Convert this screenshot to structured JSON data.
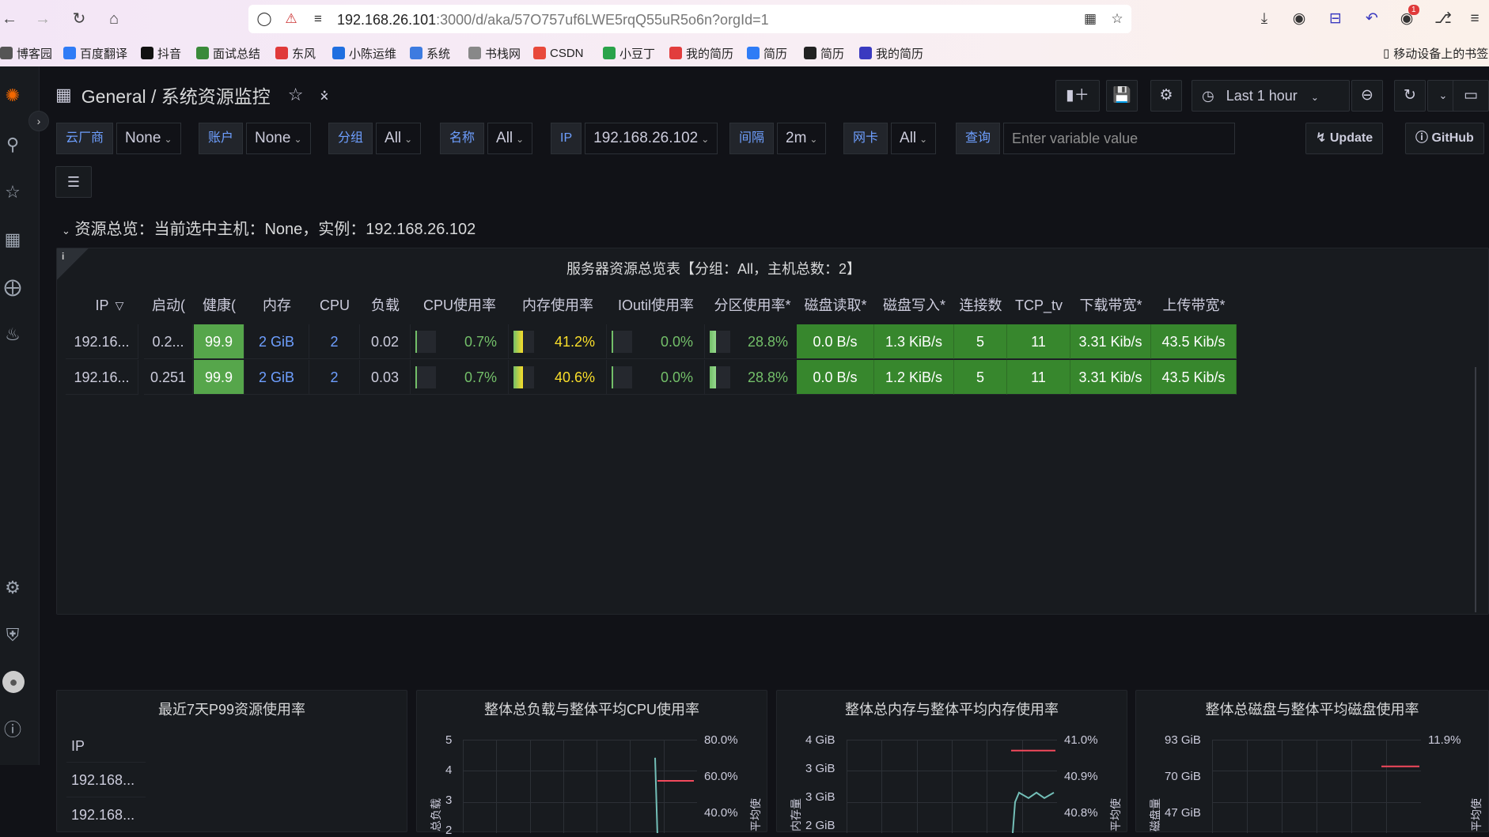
{
  "browser": {
    "url_host": "192.168.26.101",
    "url_rest": ":3000/d/aka/57O757uf6LWE5rqQ55uR5o6n?orgId=1",
    "notification_count": "1",
    "bookmarks": [
      {
        "label": "博客园",
        "icon": "cnblogs-icon",
        "color": "#555555"
      },
      {
        "label": "百度翻译",
        "icon": "translate-icon",
        "color": "#2f7cf6"
      },
      {
        "label": "抖音",
        "icon": "douyin-icon",
        "color": "#111111"
      },
      {
        "label": "面试总结",
        "icon": "plant-icon",
        "color": "#3a8a3a"
      },
      {
        "label": "东风",
        "icon": "infinity-icon",
        "color": "#e03a3a"
      },
      {
        "label": "小陈运维",
        "icon": "h-icon",
        "color": "#1f6fe0"
      },
      {
        "label": "系统",
        "icon": "swirl-icon",
        "color": "#3d7be0"
      },
      {
        "label": "书栈网",
        "icon": "book-icon",
        "color": "#888888"
      },
      {
        "label": "CSDN",
        "icon": "csdn-icon",
        "color": "#e8493b"
      },
      {
        "label": "小豆丁",
        "icon": "leaf-icon",
        "color": "#2aa34a"
      },
      {
        "label": "我的简历",
        "icon": "resume-icon",
        "color": "#e23d3d"
      },
      {
        "label": "简历",
        "icon": "e-icon",
        "color": "#2f7cf6"
      },
      {
        "label": "简历",
        "icon": "p-icon",
        "color": "#222222"
      },
      {
        "label": "我的简历",
        "icon": "chart-icon",
        "color": "#3a3ac0"
      }
    ],
    "mobile_bookmarks": "移动设备上的书签"
  },
  "dashboard": {
    "folder": "General",
    "separator": "/",
    "title": "系统资源监控",
    "time_range": "Last 1 hour"
  },
  "variables": [
    {
      "label": "云厂商",
      "value": "None"
    },
    {
      "label": "账户",
      "value": "None"
    },
    {
      "label": "分组",
      "value": "All"
    },
    {
      "label": "名称",
      "value": "All"
    },
    {
      "label": "IP",
      "value": "192.168.26.102"
    },
    {
      "label": "间隔",
      "value": "2m"
    },
    {
      "label": "网卡",
      "value": "All"
    }
  ],
  "query": {
    "label": "查询",
    "placeholder": "Enter variable value"
  },
  "links": {
    "update": "Update",
    "github": "GitHub"
  },
  "row_title": "资源总览：当前选中主机：None，实例：192.168.26.102",
  "table": {
    "title": "服务器资源总览表【分组：All，主机总数：2】",
    "info": "i",
    "headers": [
      "IP",
      "启动(",
      "健康(",
      "内存",
      "CPU",
      "负载",
      "CPU使用率",
      "内存使用率",
      "IOutil使用率",
      "分区使用率*",
      "磁盘读取*",
      "磁盘写入*",
      "连接数",
      "TCP_tv",
      "下载带宽*",
      "上传带宽*"
    ],
    "rows": [
      {
        "ip": "192.16...",
        "uptime": "0.2...",
        "health": "99.9",
        "mem": "2 GiB",
        "cpu": "2",
        "load": "0.02",
        "cpu_pct": "0.7%",
        "cpu_frac": 0.007,
        "mem_pct": "41.2%",
        "mem_frac": 0.412,
        "io_pct": "0.0%",
        "io_frac": 0.0,
        "part_pct": "28.8%",
        "part_frac": 0.288,
        "disk_read": "0.0 B/s",
        "disk_write": "1.3 KiB/s",
        "conn": "5",
        "tcp_tw": "11",
        "down_bw": "3.31 Kib/s",
        "up_bw": "43.5 Kib/s"
      },
      {
        "ip": "192.16...",
        "uptime": "0.251",
        "health": "99.9",
        "mem": "2 GiB",
        "cpu": "2",
        "load": "0.03",
        "cpu_pct": "0.7%",
        "cpu_frac": 0.007,
        "mem_pct": "40.6%",
        "mem_frac": 0.406,
        "io_pct": "0.0%",
        "io_frac": 0.0,
        "part_pct": "28.8%",
        "part_frac": 0.288,
        "disk_read": "0.0 B/s",
        "disk_write": "1.2 KiB/s",
        "conn": "5",
        "tcp_tw": "11",
        "down_bw": "3.31 Kib/s",
        "up_bw": "43.5 Kib/s"
      }
    ]
  },
  "panels": {
    "p99": {
      "title": "最近7天P99资源使用率",
      "header": "IP",
      "rows": [
        "192.168...",
        "192.168..."
      ]
    },
    "load_cpu": {
      "title": "整体总负载与整体平均CPU使用率",
      "ylabel_left": "总负载",
      "ylabel_right": "平均使"
    },
    "mem": {
      "title": "整体总内存与整体平均内存使用率",
      "ylabel_left": "内存量",
      "ylabel_right": "平均使"
    },
    "disk": {
      "title": "整体总磁盘与整体平均磁盘使用率",
      "ylabel_left": "磁盘量",
      "ylabel_right": "平均使"
    }
  },
  "chart_data": [
    {
      "type": "line",
      "title": "整体总负载与整体平均CPU使用率",
      "ylabel": "总负载",
      "y_ticks_left": [
        "5",
        "4",
        "3",
        "2"
      ],
      "y_ticks_right": [
        "80.0%",
        "60.0%",
        "40.0%"
      ],
      "series": [
        {
          "color": "#73bfb8",
          "values": [
            4.4,
            2
          ]
        },
        {
          "color": "#f2495c",
          "values": [
            60,
            60
          ]
        }
      ]
    },
    {
      "type": "line",
      "title": "整体总内存与整体平均内存使用率",
      "ylabel": "内存量",
      "y_ticks_left": [
        "4 GiB",
        "3 GiB",
        "3 GiB",
        "2 GiB"
      ],
      "y_ticks_right": [
        "41.0%",
        "40.9%",
        "40.8%"
      ],
      "series": [
        {
          "color": "#73bfb8",
          "values": [
            2.0,
            2.9,
            2.85,
            2.9
          ]
        },
        {
          "color": "#f2495c",
          "values": [
            40.98,
            40.98
          ]
        }
      ]
    },
    {
      "type": "line",
      "title": "整体总磁盘与整体平均磁盘使用率",
      "ylabel": "磁盘量",
      "y_ticks_left": [
        "93 GiB",
        "70 GiB",
        "47 GiB"
      ],
      "y_ticks_right": [
        "11.9%"
      ],
      "series": [
        {
          "color": "#f2495c",
          "values": [
            11.85,
            11.85
          ]
        }
      ]
    }
  ],
  "colors": {
    "bg": "#111217",
    "panel": "#181b1f",
    "accent_blue": "#6e9fff",
    "cell_green": "#37872d",
    "health_green": "#56a64b",
    "gauge_green": "#73bf69",
    "gauge_yellow": "#fade2a"
  }
}
